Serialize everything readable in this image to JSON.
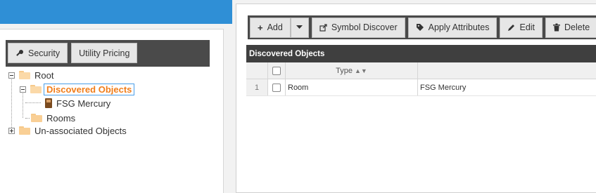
{
  "left_toolbar": {
    "security_label": "Security",
    "utility_pricing_label": "Utility Pricing"
  },
  "tree": {
    "root": "Root",
    "discovered": "Discovered Objects",
    "device": "FSG Mercury",
    "rooms": "Rooms",
    "unassociated": "Un-associated Objects"
  },
  "right_toolbar": {
    "add_label": "Add",
    "symbol_discover_label": "Symbol Discover",
    "apply_attributes_label": "Apply Attributes",
    "edit_label": "Edit",
    "delete_label": "Delete"
  },
  "grid": {
    "title": "Discovered Objects",
    "columns": [
      "Type",
      ""
    ],
    "rows": [
      {
        "num": "1",
        "type": "Room",
        "name": "FSG Mercury"
      }
    ]
  },
  "colors": {
    "header_blue": "#2f8fd6",
    "toolbar_dark": "#4a4a4a",
    "selected_orange": "#f07d1a",
    "selection_border": "#4a9ee8"
  }
}
